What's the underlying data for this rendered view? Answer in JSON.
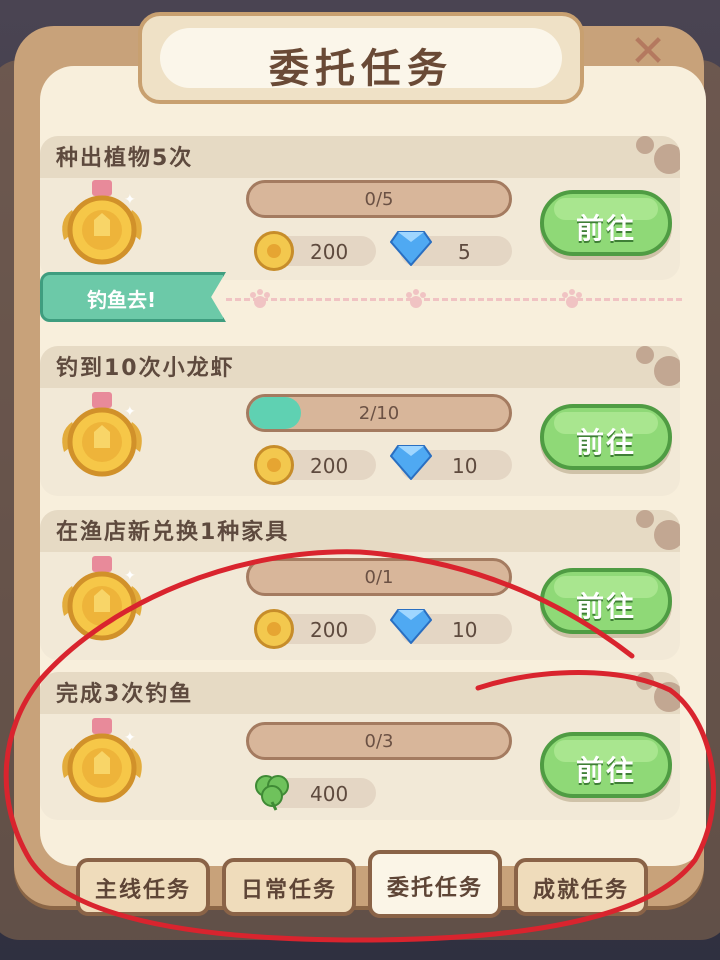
{
  "window": {
    "title": "委托任务"
  },
  "close_icon": "close-icon",
  "ribbon": {
    "label": "钓鱼去!"
  },
  "go_label": "前往",
  "tasks": [
    {
      "title": "种出植物5次",
      "progress_text": "0/5",
      "progress": 0.0,
      "rewards": [
        {
          "icon": "coin-icon",
          "value": "200"
        },
        {
          "icon": "diamond-icon",
          "value": "5"
        }
      ]
    },
    {
      "title": "钓到10次小龙虾",
      "progress_text": "2/10",
      "progress": 0.2,
      "rewards": [
        {
          "icon": "coin-icon",
          "value": "200"
        },
        {
          "icon": "diamond-icon",
          "value": "10"
        }
      ]
    },
    {
      "title": "在渔店新兑换1种家具",
      "progress_text": "0/1",
      "progress": 0.0,
      "rewards": [
        {
          "icon": "coin-icon",
          "value": "200"
        },
        {
          "icon": "diamond-icon",
          "value": "10"
        }
      ]
    },
    {
      "title": "完成3次钓鱼",
      "progress_text": "0/3",
      "progress": 0.0,
      "rewards": [
        {
          "icon": "clover-icon",
          "value": "400"
        }
      ]
    }
  ],
  "tabs": [
    {
      "label": "主线任务",
      "active": false
    },
    {
      "label": "日常任务",
      "active": false
    },
    {
      "label": "委托任务",
      "active": true
    },
    {
      "label": "成就任务",
      "active": false
    }
  ],
  "colors": {
    "go_button": "#8fd977",
    "progress_fill": "#5fd1b2",
    "annotation": "#d9242e"
  }
}
